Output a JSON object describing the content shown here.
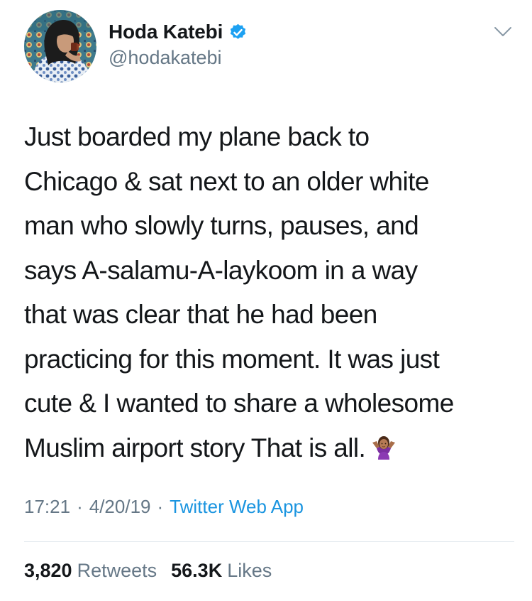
{
  "author": {
    "display_name": "Hoda Katebi",
    "handle": "@hodakatebi",
    "verified": true,
    "avatar": "profile-photo"
  },
  "tweet": {
    "text": "Just boarded my plane back to\nChicago & sat next to an older white\nman who slowly turns, pauses, and\nsays A-salamu-A-laykoom in a way\nthat was clear that he had been\npracticing for this moment. It was just\ncute & I wanted to share a wholesome\nMuslim airport story That is all.",
    "emoji": "woman-shrugging-emoji"
  },
  "meta": {
    "time": "17:21",
    "date": "4/20/19",
    "separator": "·",
    "source": "Twitter Web App"
  },
  "stats": {
    "retweets_count": "3,820",
    "retweets_label": "Retweets",
    "likes_count": "56.3K",
    "likes_label": "Likes"
  },
  "colors": {
    "text": "#14171a",
    "secondary": "#657786",
    "link": "#1b95e0",
    "verified": "#1da1f2",
    "divider": "#e1e8ed"
  }
}
